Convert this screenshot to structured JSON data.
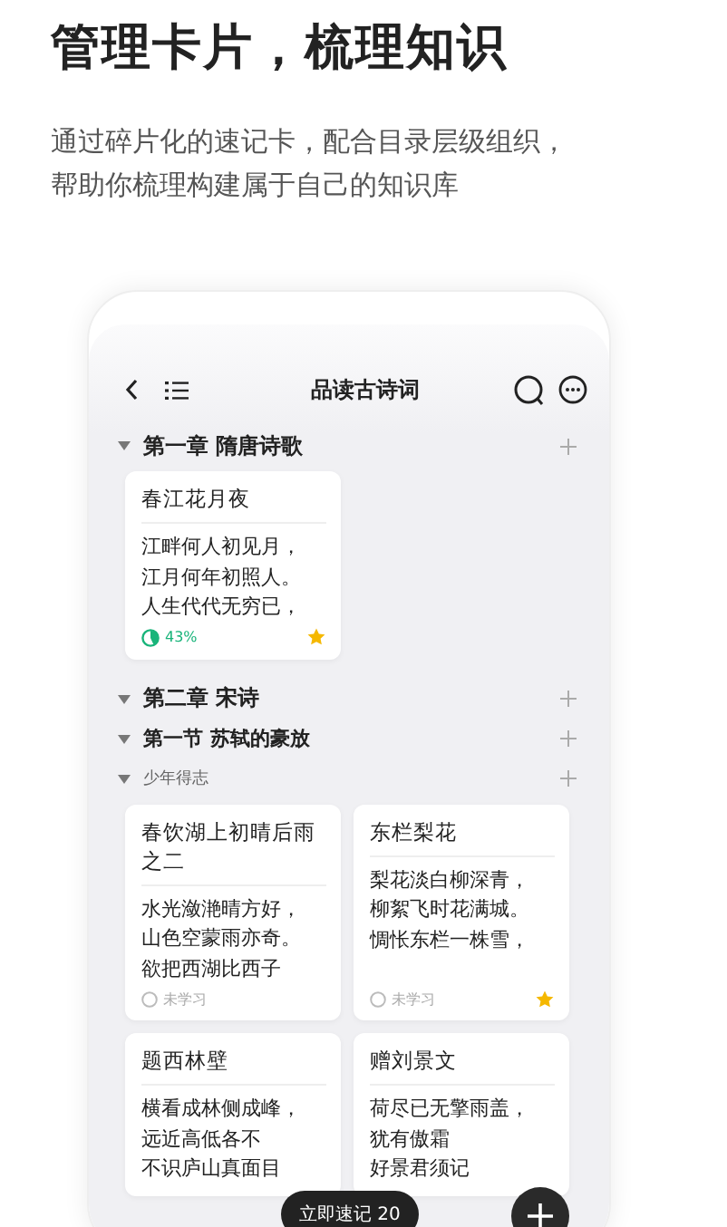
{
  "headline": "管理卡片，梳理知识",
  "subtitle_lines": [
    "通过碎片化的速记卡，配合目录层级组织，",
    "帮助你梳理构建属于自己的知识库"
  ],
  "app": {
    "title": "品读古诗词",
    "outline": [
      {
        "kind": "chapter",
        "title": "第一章 隋唐诗歌",
        "expanded": true,
        "cards": [
          {
            "title": "春江花月夜",
            "lines": [
              "江畔何人初见月，",
              "江月何年初照人。",
              "人生代代无穷已，"
            ],
            "status": {
              "kind": "progress",
              "text": "43%",
              "level": 0.43
            },
            "starred": true
          }
        ]
      },
      {
        "kind": "chapter",
        "title": "第二章 宋诗",
        "expanded": true,
        "children": [
          {
            "kind": "section",
            "title": "第一节 苏轼的豪放",
            "expanded": true,
            "children": [
              {
                "kind": "topic",
                "title": "少年得志",
                "expanded": true,
                "cards": [
                  {
                    "title": "春饮湖上初晴后雨之二",
                    "lines": [
                      "水光潋滟晴方好，",
                      "山色空蒙雨亦奇。",
                      "欲把西湖比西子"
                    ],
                    "status": {
                      "kind": "unlearned",
                      "text": "未学习"
                    },
                    "starred": false
                  },
                  {
                    "title": "东栏梨花",
                    "lines": [
                      "梨花淡白柳深青，",
                      "柳絮飞时花满城。",
                      "惆怅东栏一株雪，"
                    ],
                    "status": {
                      "kind": "unlearned",
                      "text": "未学习"
                    },
                    "starred": true
                  },
                  {
                    "title": "题西林壁",
                    "lines": [
                      "横看成林侧成峰，",
                      "远近高低各不",
                      "不识庐山真面目"
                    ]
                  },
                  {
                    "title": "赠刘景文",
                    "lines": [
                      "荷尽已无擎雨盖，",
                      "犹有傲霜",
                      "好景君须记"
                    ]
                  }
                ]
              }
            ]
          }
        ]
      }
    ],
    "quick_note_button": "立即速记 20"
  }
}
